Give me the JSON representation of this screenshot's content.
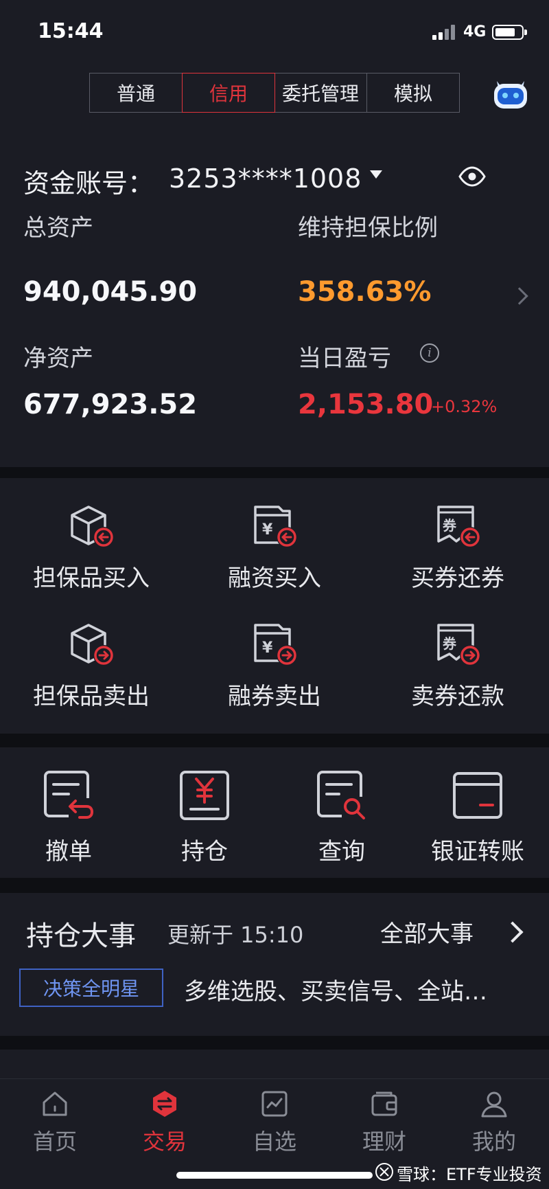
{
  "status_bar": {
    "time": "15:44",
    "network": "4G"
  },
  "tabs": [
    {
      "label": "普通",
      "active": false
    },
    {
      "label": "信用",
      "active": true
    },
    {
      "label": "委托管理",
      "active": false
    },
    {
      "label": "模拟",
      "active": false
    }
  ],
  "account": {
    "label": "资金账号：",
    "number": "3253****1008"
  },
  "metrics": {
    "total_assets_label": "总资产",
    "total_assets_value": "940,045.90",
    "maintenance_ratio_label": "维持担保比例",
    "maintenance_ratio_value": "358.63%",
    "net_assets_label": "净资产",
    "net_assets_value": "677,923.52",
    "daily_pnl_label": "当日盈亏",
    "daily_pnl_value": "2,153.80",
    "daily_pnl_pct": "+0.32%"
  },
  "credit_actions": [
    {
      "label": "担保品买入",
      "icon": "box-arrow-in-icon"
    },
    {
      "label": "融资买入",
      "icon": "yen-folder-arrow-in-icon"
    },
    {
      "label": "买券还券",
      "icon": "coupon-arrow-in-icon"
    },
    {
      "label": "担保品卖出",
      "icon": "box-arrow-out-icon"
    },
    {
      "label": "融券卖出",
      "icon": "yen-folder-arrow-out-icon"
    },
    {
      "label": "卖券还款",
      "icon": "coupon-arrow-out-icon"
    }
  ],
  "tools": [
    {
      "label": "撤单",
      "icon": "cancel-order-icon"
    },
    {
      "label": "持仓",
      "icon": "position-yen-icon"
    },
    {
      "label": "查询",
      "icon": "query-search-icon"
    },
    {
      "label": "银证转账",
      "icon": "bank-card-icon"
    }
  ],
  "events": {
    "title": "持仓大事",
    "updated": "更新于 15:10",
    "all_label": "全部大事",
    "tag": "决策全明星",
    "description": "多维选股、买卖信号、全站…"
  },
  "bottom_nav": [
    {
      "label": "首页",
      "icon": "home-icon",
      "active": false
    },
    {
      "label": "交易",
      "icon": "trade-icon",
      "active": true
    },
    {
      "label": "自选",
      "icon": "watchlist-chart-icon",
      "active": false
    },
    {
      "label": "理财",
      "icon": "wallet-icon",
      "active": false
    },
    {
      "label": "我的",
      "icon": "profile-icon",
      "active": false
    }
  ],
  "watermark": "雪球：ETF专业投资",
  "colors": {
    "accent_red": "#e0343c",
    "ratio_orange": "#ff9a2e",
    "tag_blue": "#3f62c4",
    "background": "#1b1c24"
  }
}
